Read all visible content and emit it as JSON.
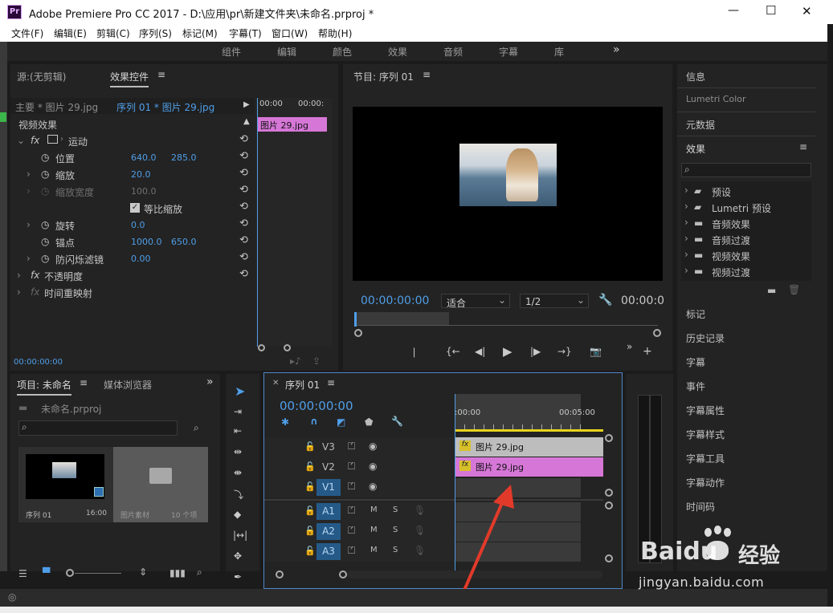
{
  "window": {
    "logo": "Pr",
    "title": "Adobe Premiere Pro CC 2017 - D:\\应用\\pr\\新建文件夹\\未命名.prproj *",
    "minimize": "—",
    "maximize": "☐",
    "close": "✕"
  },
  "menu": [
    "文件(F)",
    "编辑(E)",
    "剪辑(C)",
    "序列(S)",
    "标记(M)",
    "字幕(T)",
    "窗口(W)",
    "帮助(H)"
  ],
  "workspaces": [
    "组件",
    "编辑",
    "颜色",
    "效果",
    "音频",
    "字幕",
    "库"
  ],
  "workspace_more": "»",
  "effect_controls": {
    "tab_source": "源:(无剪辑)",
    "tab_active": "效果控件",
    "master": "主要 * 图片 29.jpg",
    "sequence_clip": "序列 01 * 图片 29.jpg",
    "video_effects": "视频效果",
    "motion": "运动",
    "position_label": "位置",
    "position_x": "640.0",
    "position_y": "285.0",
    "scale_label": "缩放",
    "scale_value": "20.0",
    "scale_width_label": "缩放宽度",
    "scale_width_value": "100.0",
    "uniform_label": "等比缩放",
    "rotation_label": "旋转",
    "rotation_value": "0.0",
    "anchor_label": "锚点",
    "anchor_x": "1000.0",
    "anchor_y": "650.0",
    "flicker_label": "防闪烁滤镜",
    "flicker_value": "0.00",
    "opacity": "不透明度",
    "time_remap": "时间重映射",
    "timecode": "00:00:00:00",
    "mini_tc1": "00:00",
    "mini_tc2": "00:00:",
    "mini_clip": "图片 29.jpg"
  },
  "program": {
    "title": "节目: 序列 01",
    "timecode": "00:00:00:00",
    "fit": "适合",
    "resolution": "1/2",
    "tc_right": "00:00:0"
  },
  "project": {
    "tab_project": "项目: 未命名",
    "tab_media": "媒体浏览器",
    "file": "未命名.prproj",
    "item1_name": "序列 01",
    "item1_duration": "16:00",
    "item2_name": "图片素材",
    "item2_count": "10 个项"
  },
  "timeline": {
    "tab": "序列 01",
    "timecode": "00:00:00:00",
    "ruler_start": ":00:00",
    "ruler_end": "00:05:00",
    "video_tracks": [
      "V3",
      "V2",
      "V1"
    ],
    "audio_tracks": [
      "A1",
      "A2",
      "A3"
    ],
    "clip_v3": "图片 29.jpg",
    "clip_v2": "图片 29.jpg",
    "clip_fx": "fx"
  },
  "right_panel": {
    "info": "信息",
    "lumetri_color": "Lumetri Color",
    "metadata": "元数据",
    "effects": "效果",
    "effect_items": [
      "预设",
      "Lumetri 预设",
      "音频效果",
      "音频过渡",
      "视频效果",
      "视频过渡"
    ],
    "lower_items": [
      "标记",
      "历史记录",
      "字幕",
      "事件",
      "字幕属性",
      "字幕样式",
      "字幕工具",
      "字幕动作",
      "时间码"
    ]
  },
  "watermark": {
    "brand": "Baidu",
    "text_cn": "经验",
    "url": "jingyan.baidu.com"
  },
  "colors": {
    "accent_blue": "#4f9ee8",
    "clip_pink": "#d677d7",
    "title_bg": "#ffffff",
    "panel_bg": "#232323"
  }
}
